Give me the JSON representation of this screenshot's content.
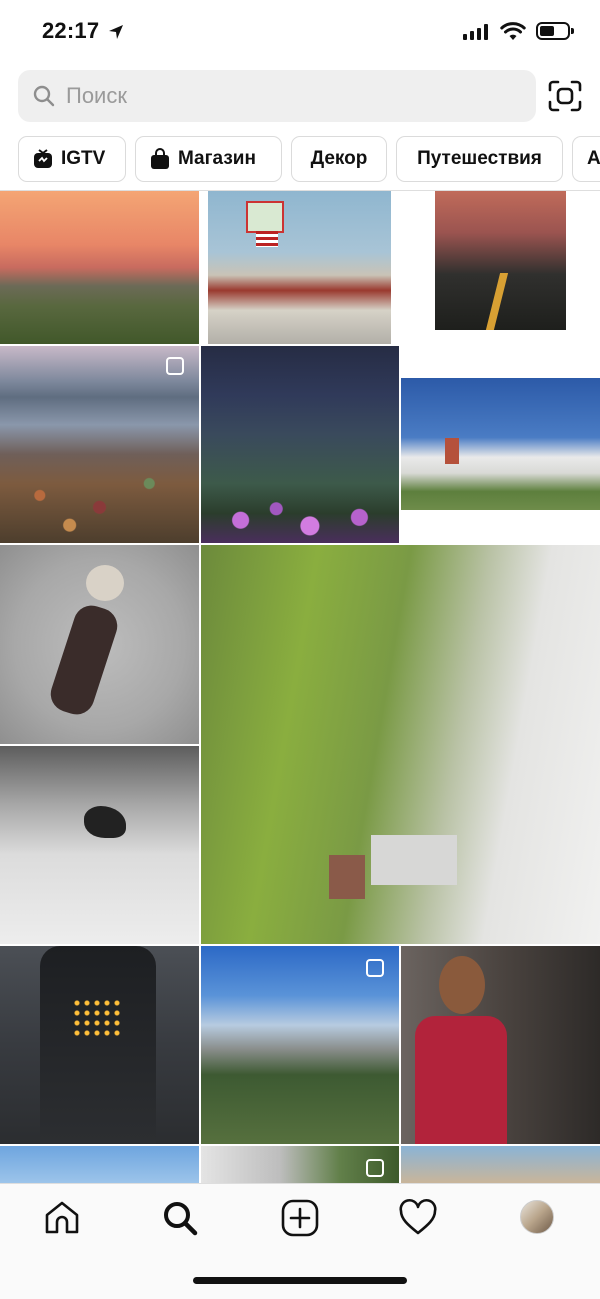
{
  "status_bar": {
    "time": "22:17"
  },
  "search": {
    "placeholder": "Поиск"
  },
  "chips": [
    {
      "label": "IGTV",
      "icon": "igtv-icon"
    },
    {
      "label": "Магазин",
      "icon": "shopping-bag-icon"
    },
    {
      "label": "Декор"
    },
    {
      "label": "Путешествия"
    },
    {
      "label": "А"
    }
  ],
  "grid": [
    {
      "name": "photo-sunset-farm"
    },
    {
      "name": "photo-motel-sign"
    },
    {
      "name": "photo-road-sunset"
    },
    {
      "name": "photo-mountain-lake",
      "multi": true
    },
    {
      "name": "photo-alpine-flowers"
    },
    {
      "name": "photo-hospital-building"
    },
    {
      "name": "photo-sleeping-baby"
    },
    {
      "name": "photo-green-mountain-fog"
    },
    {
      "name": "photo-winter-park"
    },
    {
      "name": "photo-ifc-tower"
    },
    {
      "name": "photo-modern-house",
      "multi": true
    },
    {
      "name": "photo-girl-red-dress"
    },
    {
      "name": "photo-sky"
    },
    {
      "name": "photo-cliff-clouds",
      "multi": true
    },
    {
      "name": "photo-portrait"
    }
  ],
  "tabbar": {
    "items": [
      "home-icon",
      "search-icon",
      "add-icon",
      "heart-icon",
      "profile-avatar"
    ],
    "active": "search-icon"
  }
}
